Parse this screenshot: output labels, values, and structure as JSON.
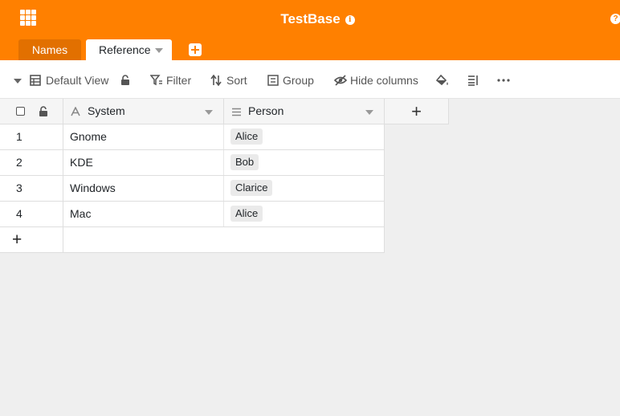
{
  "header": {
    "title": "TestBase",
    "background_color": "#ff8000",
    "apps_icon": "apps-grid-icon",
    "info_icon": "info-icon",
    "help_icon": "help-icon"
  },
  "tabs": [
    {
      "label": "Names",
      "active": false
    },
    {
      "label": "Reference",
      "active": true
    }
  ],
  "toolbar": {
    "view_label": "Default View",
    "filter_label": "Filter",
    "sort_label": "Sort",
    "group_label": "Group",
    "hide_columns_label": "Hide columns"
  },
  "columns": [
    {
      "name": "System",
      "type_icon": "text-type-icon"
    },
    {
      "name": "Person",
      "type_icon": "link-type-icon"
    }
  ],
  "rows": [
    {
      "num": "1",
      "system": "Gnome",
      "person": "Alice"
    },
    {
      "num": "2",
      "system": "KDE",
      "person": "Bob"
    },
    {
      "num": "3",
      "system": "Windows",
      "person": "Clarice"
    },
    {
      "num": "4",
      "system": "Mac",
      "person": "Alice"
    }
  ],
  "add_row_symbol": "+",
  "add_column_symbol": "+"
}
